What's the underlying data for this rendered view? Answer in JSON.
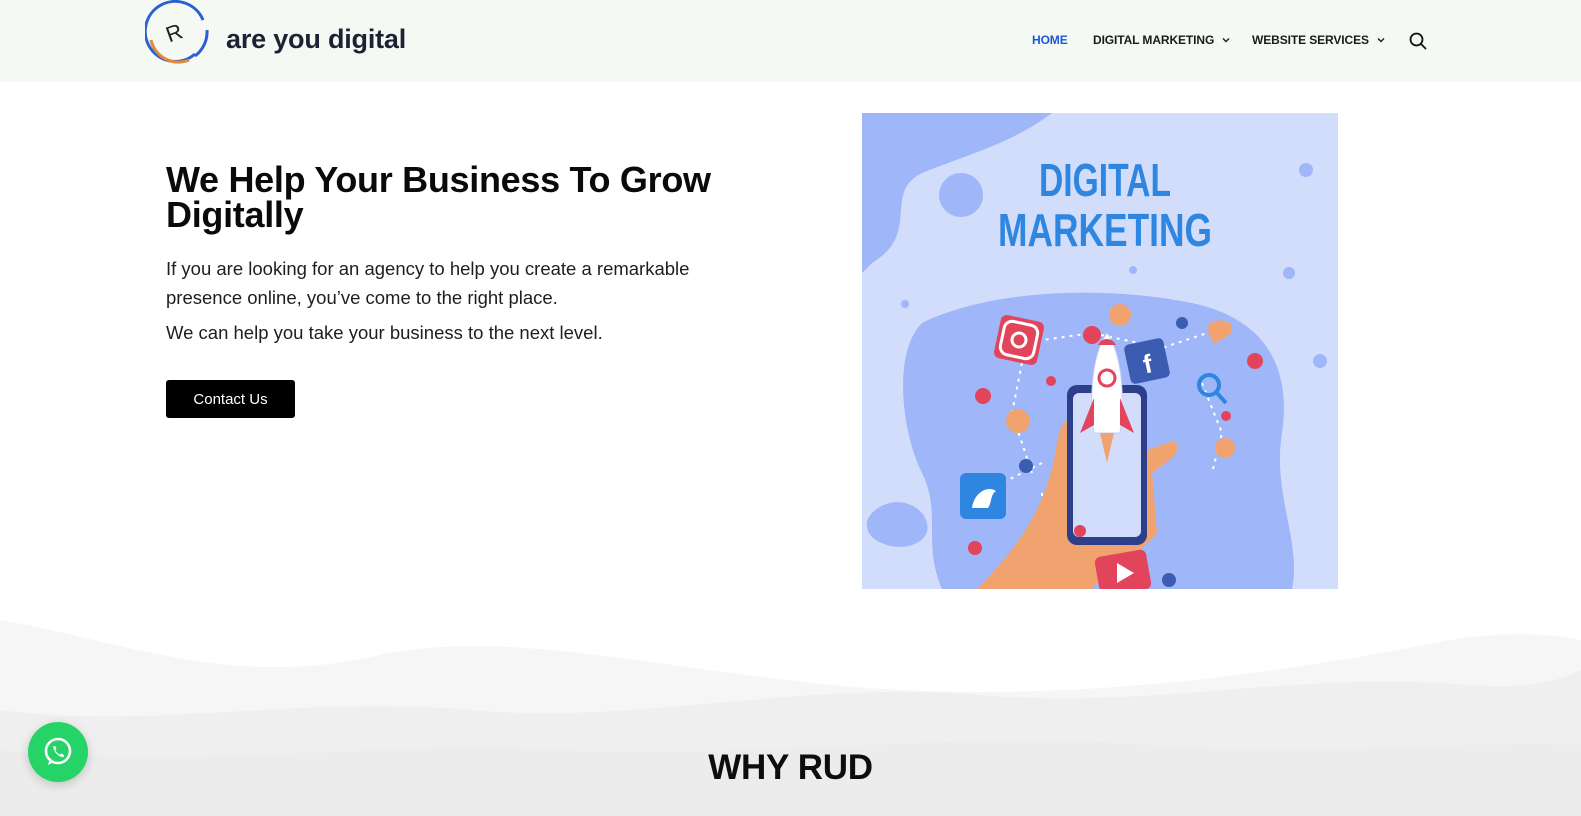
{
  "header": {
    "brand": "are you digital",
    "logo_letter": "R",
    "nav": [
      {
        "label": "HOME",
        "active": true
      },
      {
        "label": "DIGITAL MARKETING",
        "has_dropdown": true
      },
      {
        "label": "WEBSITE SERVICES",
        "has_dropdown": true
      }
    ],
    "search_icon": "search-icon"
  },
  "hero": {
    "title": "We Help Your Business To Grow Digitally",
    "paragraph_1": "If you are looking for an agency to help you create a remarkable presence online, you’ve come to the right place.",
    "paragraph_2": "We can help you take your business to the next level.",
    "cta_label": "Contact Us",
    "image": {
      "line_1": "DIGITAL",
      "line_2": "MARKETING"
    }
  },
  "why_section": {
    "title": "WHY RUD"
  },
  "floating": {
    "whatsapp_icon": "whatsapp-icon"
  },
  "colors": {
    "header_bg": "#f4faf3",
    "nav_active": "#1f56d6",
    "cta_bg": "#000000",
    "whatsapp": "#25d366",
    "image_bg": "#d2ddfb",
    "image_blob": "#9fb7f8",
    "image_text": "#2f86e0"
  }
}
